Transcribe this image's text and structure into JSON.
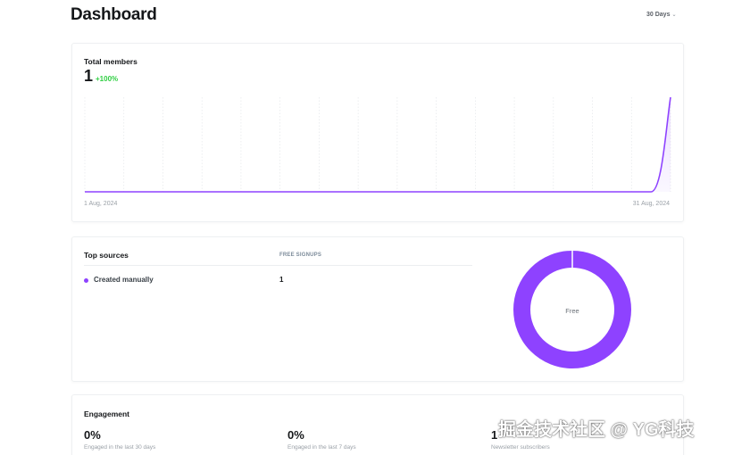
{
  "page": {
    "title": "Dashboard",
    "date_range": "30 Days"
  },
  "members_card": {
    "label": "Total members",
    "value": "1",
    "change": "+100%",
    "start_date": "1 Aug, 2024",
    "end_date": "31 Aug, 2024"
  },
  "sources_card": {
    "label": "Top sources",
    "column_header": "FREE SIGNUPS",
    "rows": [
      {
        "name": "Created manually",
        "value": "1"
      }
    ],
    "donut_label": "Free"
  },
  "engagement_card": {
    "label": "Engagement",
    "metrics": [
      {
        "value": "0%",
        "description": "Engaged in the last 30 days"
      },
      {
        "value": "0%",
        "description": "Engaged in the last 7 days"
      },
      {
        "value": "1",
        "description": "Newsletter subscribers"
      }
    ]
  },
  "watermark": "掘金技术社区 @ YG科技",
  "colors": {
    "accent_purple": "#8e42ff",
    "positive_green": "#30cf43"
  },
  "chart_data": {
    "type": "area",
    "x": [
      "1 Aug, 2024",
      "31 Aug, 2024"
    ],
    "series": [
      {
        "values": [
          0,
          0,
          0,
          0,
          0,
          0,
          0,
          0,
          0,
          0,
          0,
          0,
          0,
          0,
          0,
          0,
          0,
          0,
          0,
          0,
          0,
          0,
          0,
          0,
          0,
          0,
          0,
          0,
          0,
          0,
          1
        ]
      }
    ],
    "ylim": [
      0,
      1
    ],
    "grid": true
  }
}
